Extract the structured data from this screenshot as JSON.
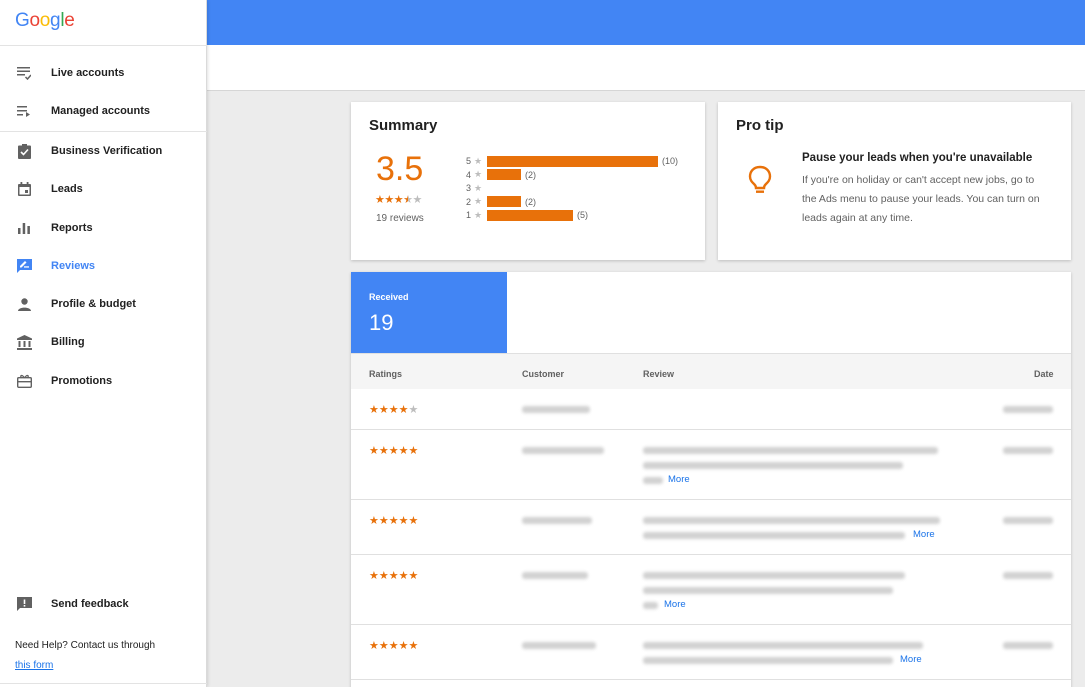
{
  "brand": {
    "logo_letters": [
      "G",
      "o",
      "o",
      "g",
      "l",
      "e"
    ],
    "logo_colors": [
      "#4285f4",
      "#ea4335",
      "#fbbc05",
      "#4285f4",
      "#34a853",
      "#ea4335"
    ]
  },
  "colors": {
    "accent": "#4285f4",
    "star": "#e8710a",
    "link": "#1a73e8"
  },
  "sidebar": {
    "items": [
      {
        "label": "Live accounts",
        "icon": "list-check-icon"
      },
      {
        "label": "Managed accounts",
        "icon": "playlist-play-icon"
      },
      {
        "label": "Business Verification",
        "icon": "clipboard-check-icon"
      },
      {
        "label": "Leads",
        "icon": "calendar-icon"
      },
      {
        "label": "Reports",
        "icon": "bar-chart-icon"
      },
      {
        "label": "Reviews",
        "icon": "rate-review-icon",
        "active": true
      },
      {
        "label": "Profile & budget",
        "icon": "person-icon"
      },
      {
        "label": "Billing",
        "icon": "bank-icon"
      },
      {
        "label": "Promotions",
        "icon": "gift-card-icon"
      }
    ],
    "feedback_label": "Send feedback",
    "help_text": "Need Help? Contact us through",
    "help_link": "this form"
  },
  "summary": {
    "title": "Summary",
    "average": "3.5",
    "average_stars": 3.5,
    "review_count_text": "19 reviews",
    "histogram": [
      {
        "stars": "5",
        "count": 10,
        "count_label": "(10)"
      },
      {
        "stars": "4",
        "count": 2,
        "count_label": "(2)"
      },
      {
        "stars": "3",
        "count": 0,
        "count_label": ""
      },
      {
        "stars": "2",
        "count": 2,
        "count_label": "(2)"
      },
      {
        "stars": "1",
        "count": 5,
        "count_label": "(5)"
      }
    ]
  },
  "tip": {
    "title": "Pro tip",
    "headline": "Pause your leads when you're unavailable",
    "body": "If you're on holiday or can't accept new jobs, go to the Ads menu to pause your leads. You can turn on leads again at any time."
  },
  "received": {
    "label": "Received",
    "value": "19"
  },
  "table": {
    "headers": {
      "ratings": "Ratings",
      "customer": "Customer",
      "review": "Review",
      "date": "Date"
    },
    "more_label": "More",
    "rows": [
      {
        "rating": 4
      },
      {
        "rating": 5
      },
      {
        "rating": 5
      },
      {
        "rating": 5
      },
      {
        "rating": 5
      }
    ]
  }
}
